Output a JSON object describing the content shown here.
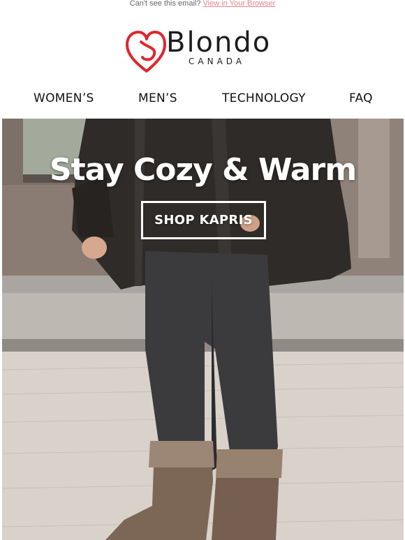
{
  "preheader": {
    "text": "Can't see this email?",
    "link_label": "View in Your Browser"
  },
  "brand": {
    "name": "Blondo",
    "subtitle": "CANADA",
    "logo_icon": "heart-b-logo",
    "accent_color": "#e0262d"
  },
  "nav": {
    "items": [
      {
        "label": "WOMEN’S"
      },
      {
        "label": "MEN’S"
      },
      {
        "label": "TECHNOLOGY"
      },
      {
        "label": "FAQ"
      }
    ]
  },
  "hero": {
    "title": "Stay Cozy & Warm",
    "cta_label": "SHOP KAPRIS",
    "image": "woman in dark parka, black jeans and fur-trimmed brown winter boots on cobblestone street"
  }
}
